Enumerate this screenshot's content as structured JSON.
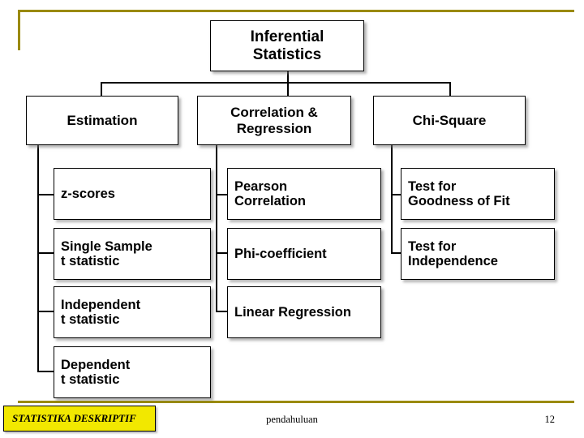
{
  "slide": {
    "accent_color": "#9a8a00",
    "footer": {
      "badge_label": "STATISTIKA DESKRIPTIF",
      "center_label": "pendahuluan",
      "page_number": "12"
    }
  },
  "diagram": {
    "root": {
      "label": "Inferential\nStatistics"
    },
    "branches": [
      {
        "label": "Estimation",
        "leaves": [
          {
            "label": "z-scores"
          },
          {
            "label": "Single Sample\nt statistic"
          },
          {
            "label": "Independent\nt statistic"
          },
          {
            "label": "Dependent\nt statistic"
          }
        ]
      },
      {
        "label": "Correlation &\nRegression",
        "leaves": [
          {
            "label": "Pearson\nCorrelation"
          },
          {
            "label": "Phi-coefficient"
          },
          {
            "label": "Linear Regression"
          }
        ]
      },
      {
        "label": "Chi-Square",
        "leaves": [
          {
            "label": "Test for\nGoodness of Fit"
          },
          {
            "label": "Test for\nIndependence"
          }
        ]
      }
    ]
  }
}
